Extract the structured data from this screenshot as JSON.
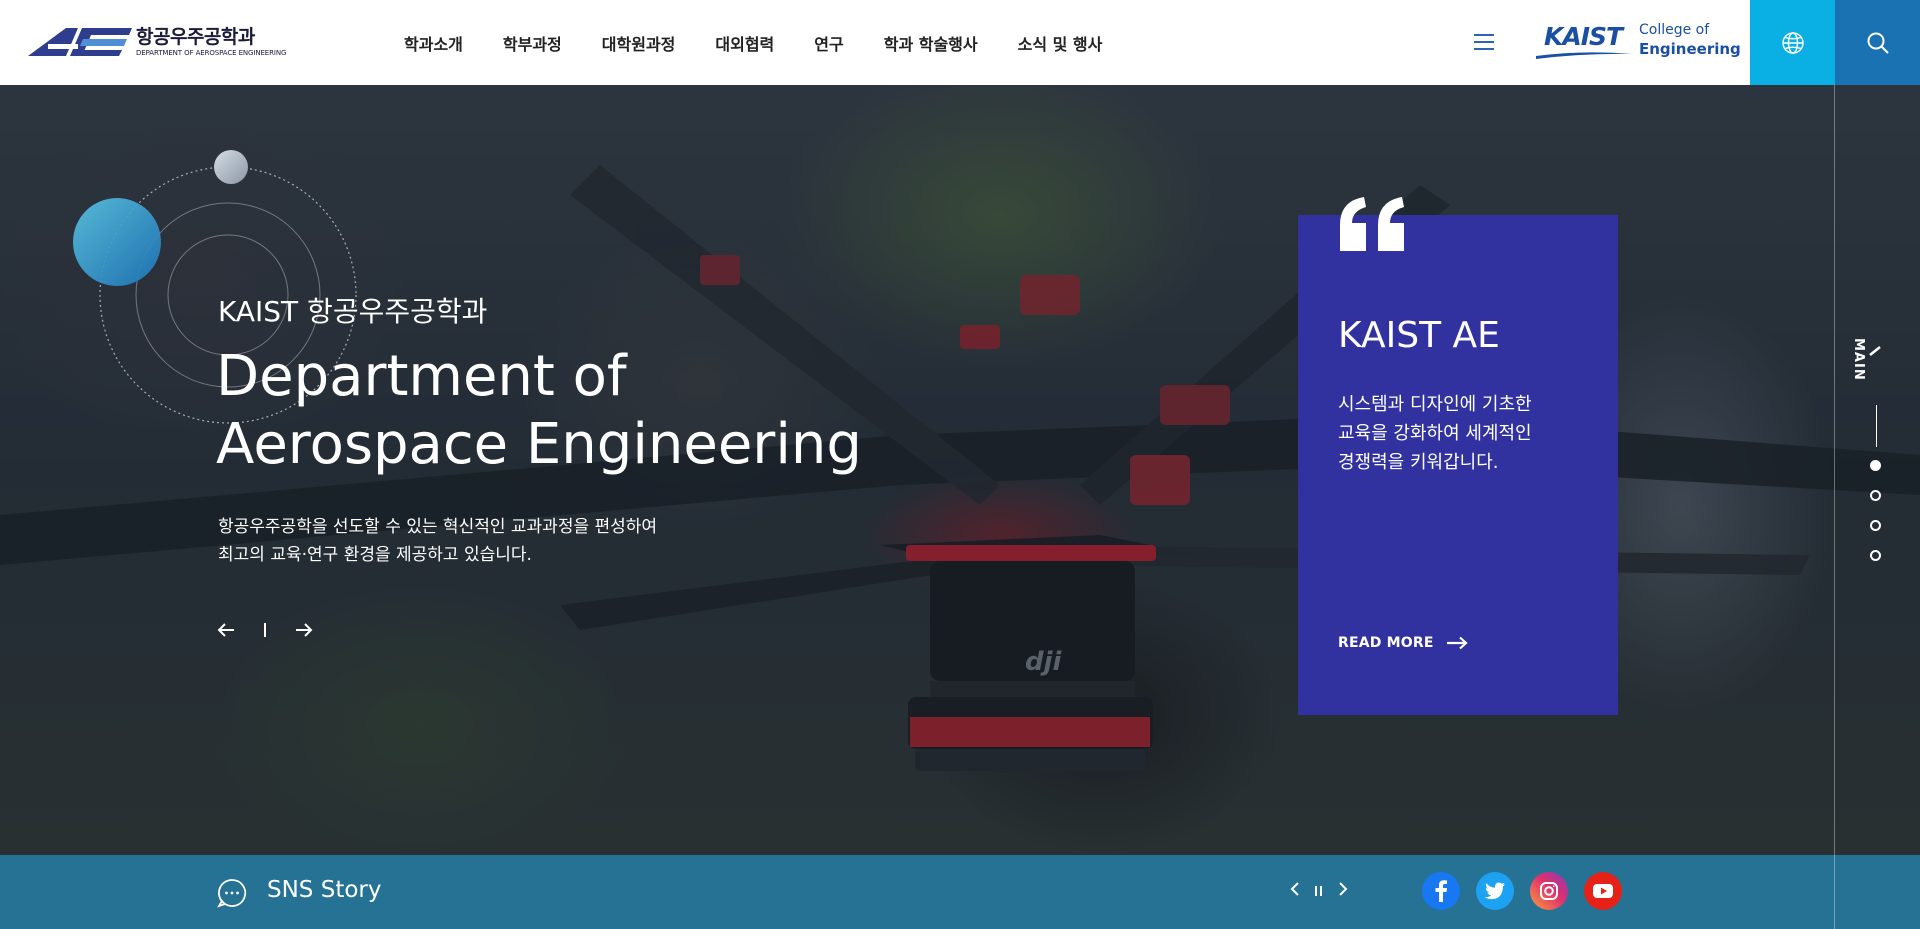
{
  "header": {
    "logo": {
      "abbr": "AE",
      "korean": "항공우주공학과",
      "english": "DEPARTMENT OF AEROSPACE ENGINEERING"
    },
    "nav": [
      {
        "label": "학과소개"
      },
      {
        "label": "학부과정"
      },
      {
        "label": "대학원과정"
      },
      {
        "label": "대외협력"
      },
      {
        "label": "연구"
      },
      {
        "label": "학과 학술행사"
      },
      {
        "label": "소식 및 행사"
      }
    ],
    "college_logo": {
      "kaist": "KAIST",
      "line1": "College of",
      "line2": "Engineering"
    },
    "icons": {
      "menu": "hamburger-icon",
      "language": "globe-icon",
      "search": "search-icon"
    }
  },
  "hero": {
    "subtitle": "KAIST 항공우주공학과",
    "title_line1": "Department of",
    "title_line2": "Aerospace Engineering",
    "desc_line1": "항공우주공학을 선도할 수 있는 혁신적인 교과과정을 편성하여",
    "desc_line2": "최고의 교육·연구 환경을 제공하고 있습니다."
  },
  "card": {
    "title": "KAIST AE",
    "text_line1": "시스템과 디자인에 기초한",
    "text_line2": "교육을 강화하여 세계적인",
    "text_line3": "경쟁력을 키워갑니다.",
    "read_more": "READ MORE"
  },
  "rail": {
    "label": "MAIN",
    "dots": 4,
    "active_dot": 1
  },
  "sns": {
    "title": "SNS Story",
    "networks": [
      "facebook",
      "twitter",
      "instagram",
      "youtube"
    ]
  },
  "colors": {
    "card": "#3132a0",
    "lang_button": "#0ab0e4",
    "search_button": "#1a72b3",
    "sns_bar": "#26779c",
    "nav_accent": "#2b63b6",
    "facebook": "#1877f2",
    "twitter": "#1da1f2",
    "instagram": "#e1306c",
    "youtube": "#e62117"
  }
}
